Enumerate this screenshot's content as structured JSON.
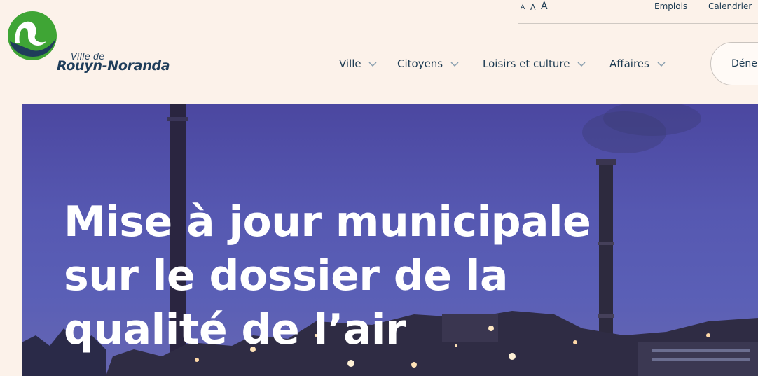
{
  "logo": {
    "small": "Ville de",
    "big": "Rouyn-Noranda",
    "colors": {
      "green": "#3fa535",
      "navy": "#1f3d5a"
    }
  },
  "utility": {
    "font_sizes": [
      "A",
      "A",
      "A"
    ],
    "links": [
      "Emplois",
      "Calendrier"
    ]
  },
  "nav": {
    "items": [
      "Ville",
      "Citoyens",
      "Loisirs et culture",
      "Affaires"
    ]
  },
  "cta": {
    "label": "Dénei"
  },
  "hero": {
    "title_lines": [
      "Mise à jour municipale",
      "sur le dossier de la",
      "qualité de l’air"
    ]
  },
  "colors": {
    "background": "#fcf2ea",
    "text": "#1d3b52",
    "hero_sky": "#5658b1"
  }
}
